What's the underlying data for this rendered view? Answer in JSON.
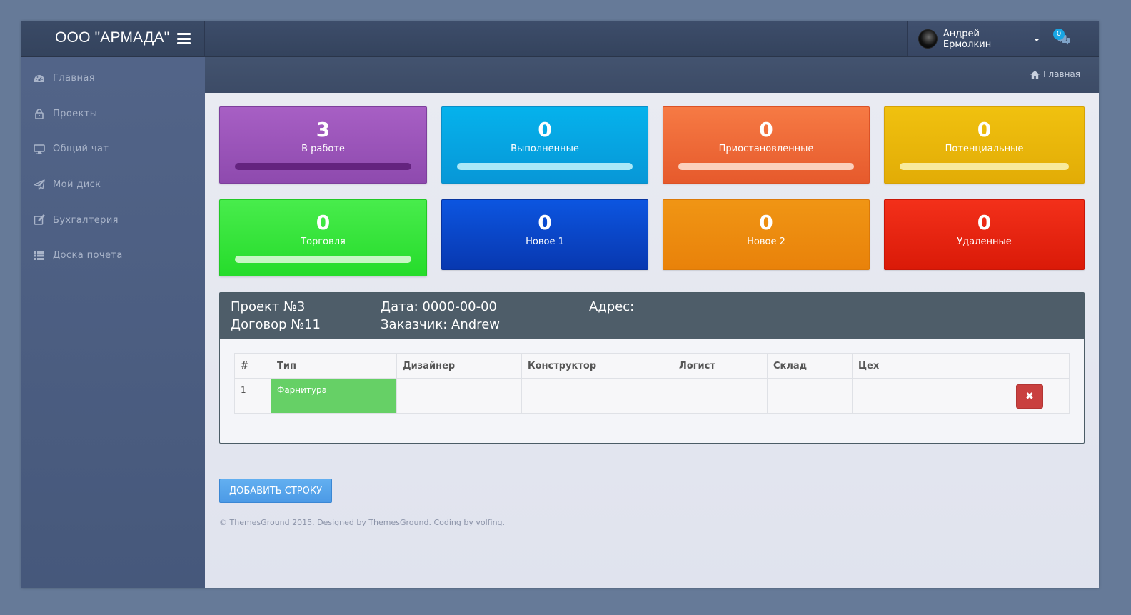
{
  "brand": {
    "title": "ООО \"АРМАДА\""
  },
  "sidebar": {
    "items": [
      {
        "label": "Главная",
        "icon": "dashboard-icon"
      },
      {
        "label": "Проекты",
        "icon": "lock-icon"
      },
      {
        "label": "Общий чат",
        "icon": "desktop-icon"
      },
      {
        "label": "Мой диск",
        "icon": "paper-plane-icon"
      },
      {
        "label": "Бухгалтерия",
        "icon": "edit-icon"
      },
      {
        "label": "Доска почета",
        "icon": "list-icon"
      }
    ]
  },
  "topbar": {
    "user_name": "Андрей Ермолкин",
    "chat_count": "0"
  },
  "breadcrumb": {
    "label": "Главная"
  },
  "tiles": [
    {
      "count": "3",
      "label": "В работе",
      "color": "#9b59b6"
    },
    {
      "count": "0",
      "label": "Выполненные",
      "color": "#03a9f4"
    },
    {
      "count": "0",
      "label": "Приостановленные",
      "color": "#f26a3a"
    },
    {
      "count": "0",
      "label": "Потенциальные",
      "color": "#ebb80b"
    },
    {
      "count": "0",
      "label": "Торговля",
      "color": "#3ddf3d"
    },
    {
      "count": "0",
      "label": "Новое 1",
      "color": "#0b4ed4"
    },
    {
      "count": "0",
      "label": "Новое 2",
      "color": "#f0890f"
    },
    {
      "count": "0",
      "label": "Удаленные",
      "color": "#e62010"
    }
  ],
  "project": {
    "number": "Проект №3",
    "contract": "Договор №11",
    "date": "Дата: 0000-00-00",
    "customer": "Заказчик: Andrew",
    "address": "Адрес:"
  },
  "table": {
    "headers": [
      "#",
      "Тип",
      "Дизайнер",
      "Конструктор",
      "Логист",
      "Склад",
      "Цех",
      "",
      "",
      "",
      ""
    ],
    "rows": [
      {
        "num": "1",
        "type": "Фарнитура",
        "delete_label": "✖"
      }
    ]
  },
  "add_row_label": "ДОБАВИТЬ СТРОКУ",
  "footer": "© ThemesGround 2015. Designed by ThemesGround. Coding by volfing."
}
